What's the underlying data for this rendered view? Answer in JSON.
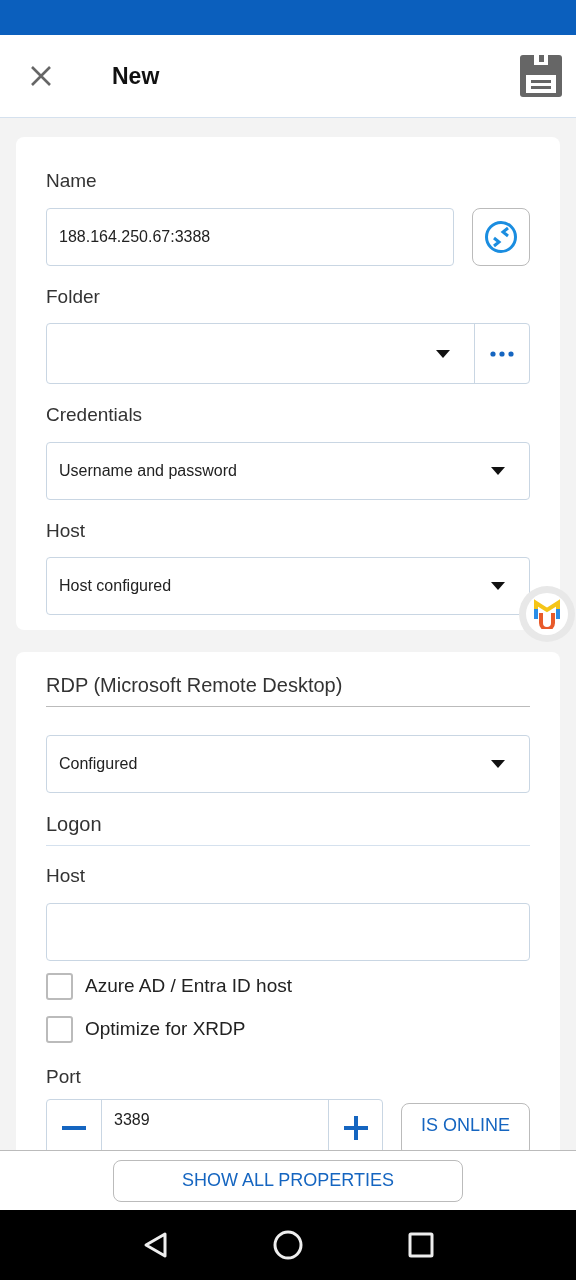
{
  "header": {
    "title": "New"
  },
  "general": {
    "fields": [
      {
        "kind": "name",
        "label": "Name",
        "value": "188.164.250.67:3388"
      },
      {
        "kind": "folder",
        "label": "Folder"
      },
      {
        "kind": "select",
        "label": "Credentials",
        "value": "Username and password"
      },
      {
        "kind": "select",
        "label": "Host",
        "value": "Host configured"
      }
    ]
  },
  "rdp": {
    "title": "RDP (Microsoft Remote Desktop)",
    "mode": "Configured",
    "logon_title": "Logon",
    "host_label": "Host",
    "checkboxes": [
      {
        "label": "Azure AD / Entra ID host",
        "checked": false
      },
      {
        "label": "Optimize for XRDP",
        "checked": false
      }
    ],
    "port_label": "Port",
    "port_value": "3389",
    "online_button": "IS ONLINE"
  },
  "footer_button": "SHOW ALL PROPERTIES"
}
